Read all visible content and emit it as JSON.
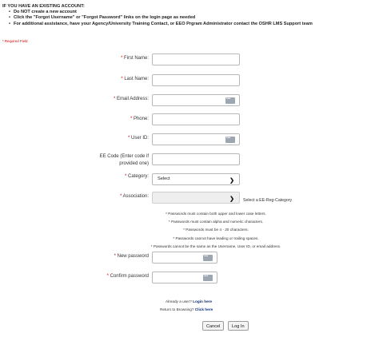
{
  "header": {
    "title": "IF YOU HAVE AN EXISTING ACCOUNT:",
    "bullets": [
      "Do NOT create a new account",
      "Click the \"Forgot Username\" or \"Forgot Password\" links on the login page as needed",
      "For additional assistance, have your Agency/University Training Contact, or EEO Prgram Administrator contact the OSHR LMS Support team"
    ]
  },
  "required_note": "* Required Field",
  "form": {
    "first_name": {
      "label": "First Name:",
      "value": ""
    },
    "last_name": {
      "label": "Last Name:",
      "value": ""
    },
    "email": {
      "label": "Email Address:",
      "value": ""
    },
    "phone": {
      "label": "Phone:",
      "value": ""
    },
    "user_id": {
      "label": "User ID:",
      "value": ""
    },
    "ee_code": {
      "label_line1": "EE Code (Enter code if",
      "label_line2": "provided one)",
      "value": ""
    },
    "category": {
      "label": "Category:",
      "selected": "Select"
    },
    "association": {
      "label": "Association:",
      "selected": "",
      "hint": "Select a EE-Reg-Category"
    },
    "new_password": {
      "label": "New password",
      "value": ""
    },
    "confirm_password": {
      "label": "Confirm password",
      "value": ""
    }
  },
  "password_rules": [
    "* Passwords must contain both upper and lower case letters.",
    "* Passwords must contain alpha and numeric characters.",
    "* Passwords must be 4 - 20 characters.",
    "* Passwords cannot have leading or trailing spaces.",
    "* Passwords cannot be the same as the Username, User ID, or email address."
  ],
  "footer": {
    "already_user_text": "Already a user?",
    "login_link": "Login here",
    "return_text": "Return to Browsing?",
    "click_link": "Click here"
  },
  "buttons": {
    "cancel": "Cancel",
    "login": "Log In"
  }
}
